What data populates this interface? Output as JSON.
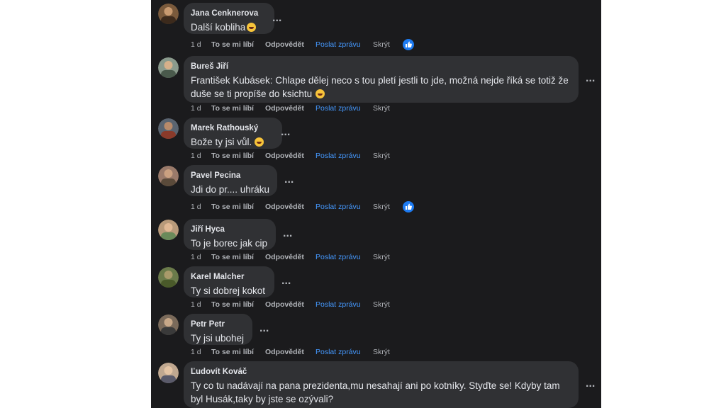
{
  "comments": [
    {
      "author": "Jana Cenknerova",
      "lines": [
        "Další kobliha"
      ],
      "emoji": "grinning-sweat-emoji",
      "time": "1 d",
      "like": "To se mi líbí",
      "reply": "Odpovědět",
      "send": "Poslat zprávu",
      "hide": "Skrýt",
      "reaction": "like-reaction",
      "avatar_color": "#7a5a3c"
    },
    {
      "author": "Bureš Jiří",
      "lines": [
        "František Kubásek: Chlape dělej neco s tou pletí jestli to jde, možná nejde říká se totiž že",
        "duše se ti propíše do ksichtu"
      ],
      "emoji": "grinning-sweat-emoji",
      "time": "1 d",
      "like": "To se mi líbí",
      "reply": "Odpovědět",
      "send": "Poslat zprávu",
      "hide": "Skrýt",
      "avatar_color": "#8a9a8c"
    },
    {
      "author": "Marek Rathouský",
      "lines": [
        "Bože ty jsi vůl."
      ],
      "emoji": "tongue-wink-emoji",
      "time": "1 d",
      "like": "To se mi líbí",
      "reply": "Odpovědět",
      "send": "Poslat zprávu",
      "hide": "Skrýt",
      "avatar_color": "#5a6470"
    },
    {
      "author": "Pavel Pecina",
      "lines": [
        "Jdi do pr.... uhráku"
      ],
      "time": "1 d",
      "like": "To se mi líbí",
      "reply": "Odpovědět",
      "send": "Poslat zprávu",
      "hide": "Skrýt",
      "reaction": "like-reaction",
      "avatar_color": "#9a7a6a"
    },
    {
      "author": "Jiří Hyca",
      "lines": [
        "To je borec jak cip"
      ],
      "time": "1 d",
      "like": "To se mi líbí",
      "reply": "Odpovědět",
      "send": "Poslat zprávu",
      "hide": "Skrýt",
      "avatar_color": "#b89a7a"
    },
    {
      "author": "Karel Malcher",
      "lines": [
        "Ty si dobrej kokot"
      ],
      "time": "1 d",
      "like": "To se mi líbí",
      "reply": "Odpovědět",
      "send": "Poslat zprávu",
      "hide": "Skrýt",
      "avatar_color": "#6a7a4a"
    },
    {
      "author": "Petr Petr",
      "lines": [
        "Ty jsi ubohej"
      ],
      "time": "1 d",
      "like": "To se mi líbí",
      "reply": "Odpovědět",
      "send": "Poslat zprávu",
      "hide": "Skrýt",
      "avatar_color": "#7a6a5a"
    },
    {
      "author": "Ľudovít Kováč",
      "lines": [
        "Ty co tu nadávají na pana prezidenta,mu nesahají ani po kotníky. Styďte se! Kdyby tam",
        "byl Husák,taky by jste se ozývali?"
      ],
      "avatar_color": "#c0a890"
    }
  ],
  "more_options_label": "...",
  "colors": {
    "background": "#1b1b1d",
    "bubble": "#303134",
    "text": "#e4e6eb",
    "muted": "#b0b3b8",
    "link": "#4599ff",
    "like_badge": "#1d7bf2"
  }
}
